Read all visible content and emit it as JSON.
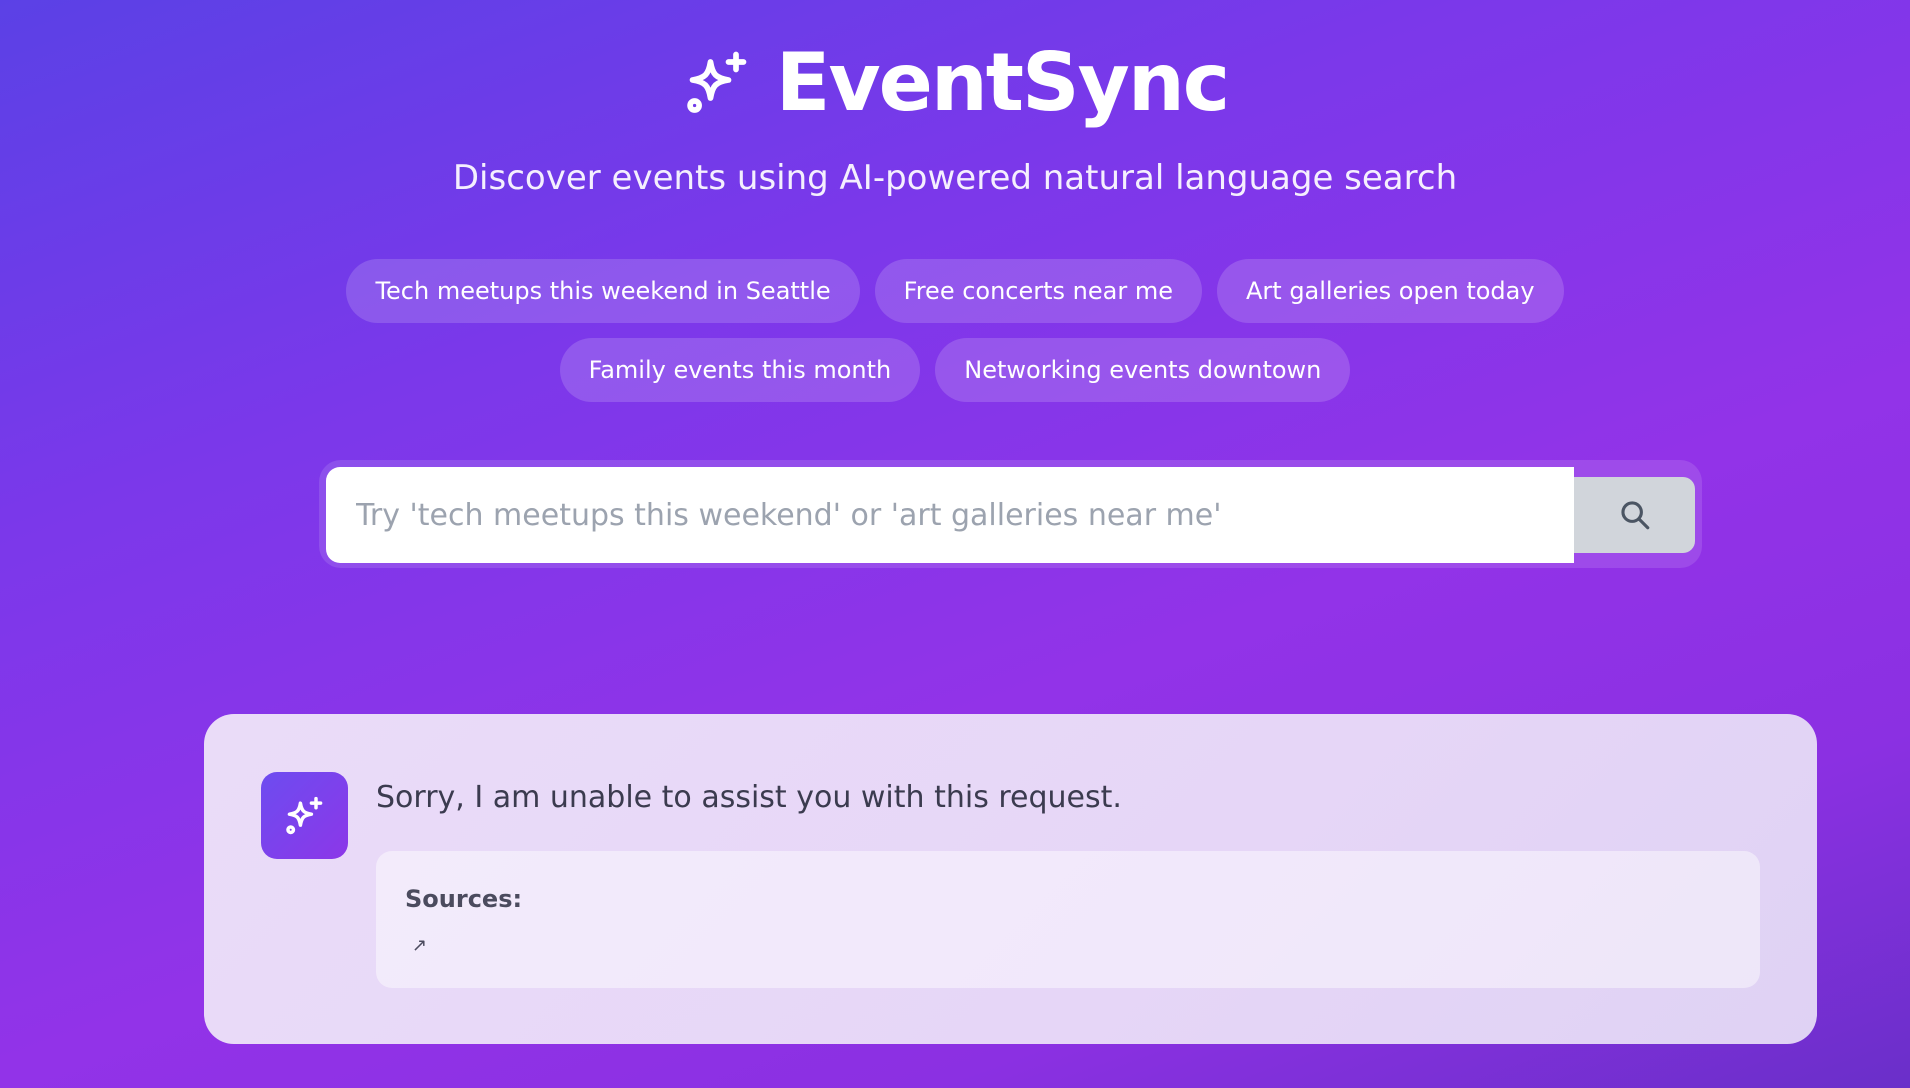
{
  "header": {
    "logo_icon": "sparkles-icon",
    "title": "EventSync",
    "subtitle": "Discover events using AI-powered natural language search"
  },
  "suggestions": {
    "row1": [
      {
        "label": "Tech meetups this weekend in Seattle"
      },
      {
        "label": "Free concerts near me"
      },
      {
        "label": "Art galleries open today"
      }
    ],
    "row2": [
      {
        "label": "Family events this month"
      },
      {
        "label": "Networking events downtown"
      }
    ]
  },
  "search": {
    "value": "",
    "placeholder": "Try 'tech meetups this weekend' or 'art galleries near me'",
    "button_icon": "search-icon"
  },
  "response": {
    "avatar_icon": "sparkles-icon",
    "message": "Sorry, I am unable to assist you with this request.",
    "sources_label": "Sources:",
    "source_link_glyph": "↗"
  },
  "colors": {
    "background_start": "#5b41e6",
    "background_mid": "#9233e8",
    "card_background": "#e8d9f8",
    "search_button": "#d1d5db",
    "text_dark": "#3b3b4f"
  }
}
